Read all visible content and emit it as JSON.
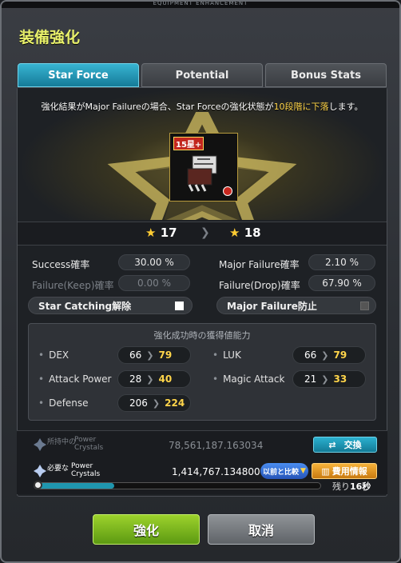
{
  "window": {
    "header": "EQUIPMENT ENHANCEMENT",
    "title": "装備強化"
  },
  "tabs": [
    {
      "label": "Star Force",
      "active": true
    },
    {
      "label": "Potential",
      "active": false
    },
    {
      "label": "Bonus Stats",
      "active": false
    }
  ],
  "warning": {
    "prefix": "強化結果がMajor Failureの場合、Star Forceの強化状態が",
    "highlight": "10段階に下落",
    "suffix": "します。"
  },
  "item": {
    "badge": "15星+"
  },
  "stars": {
    "current": "17",
    "next": "18"
  },
  "rates": {
    "success_label": "Success確率",
    "success_value": "30.00 %",
    "keep_label": "Failure(Keep)確率",
    "keep_value": "0.00 %",
    "major_label": "Major Failure確率",
    "major_value": "2.10 %",
    "drop_label": "Failure(Drop)確率",
    "drop_value": "67.90 %"
  },
  "toggles": {
    "star_catching_label": "Star Catching解除",
    "star_catching_checked": false,
    "major_failure_label": "Major Failure防止",
    "major_failure_checked": false
  },
  "gains": {
    "title": "強化成功時の獲得値能力",
    "rows": [
      {
        "label": "DEX",
        "from": "66",
        "to": "79"
      },
      {
        "label": "LUK",
        "from": "66",
        "to": "79"
      },
      {
        "label": "Attack Power",
        "from": "28",
        "to": "40"
      },
      {
        "label": "Magic Attack",
        "from": "21",
        "to": "33"
      },
      {
        "label": "Defense",
        "from": "206",
        "to": "224"
      }
    ]
  },
  "crystals": {
    "owned_prefix": "所持中の",
    "owned_label": "Power Crystals",
    "owned_value": "78,561,187.163034",
    "exchange_label": "交換",
    "need_prefix": "必要な",
    "need_label": "Power Crystals",
    "need_value": "1,414,767.134800",
    "compare_label": "以前と比較",
    "cost_label": "費用情報"
  },
  "progress": {
    "fraction": 0.28,
    "remain_prefix": "残り",
    "remain_value": "16秒"
  },
  "buttons": {
    "ok": "強化",
    "cancel": "取消"
  },
  "colors": {
    "accent": "#1f96ae",
    "gold": "#ffd54a",
    "ok": "#7bb81e"
  }
}
